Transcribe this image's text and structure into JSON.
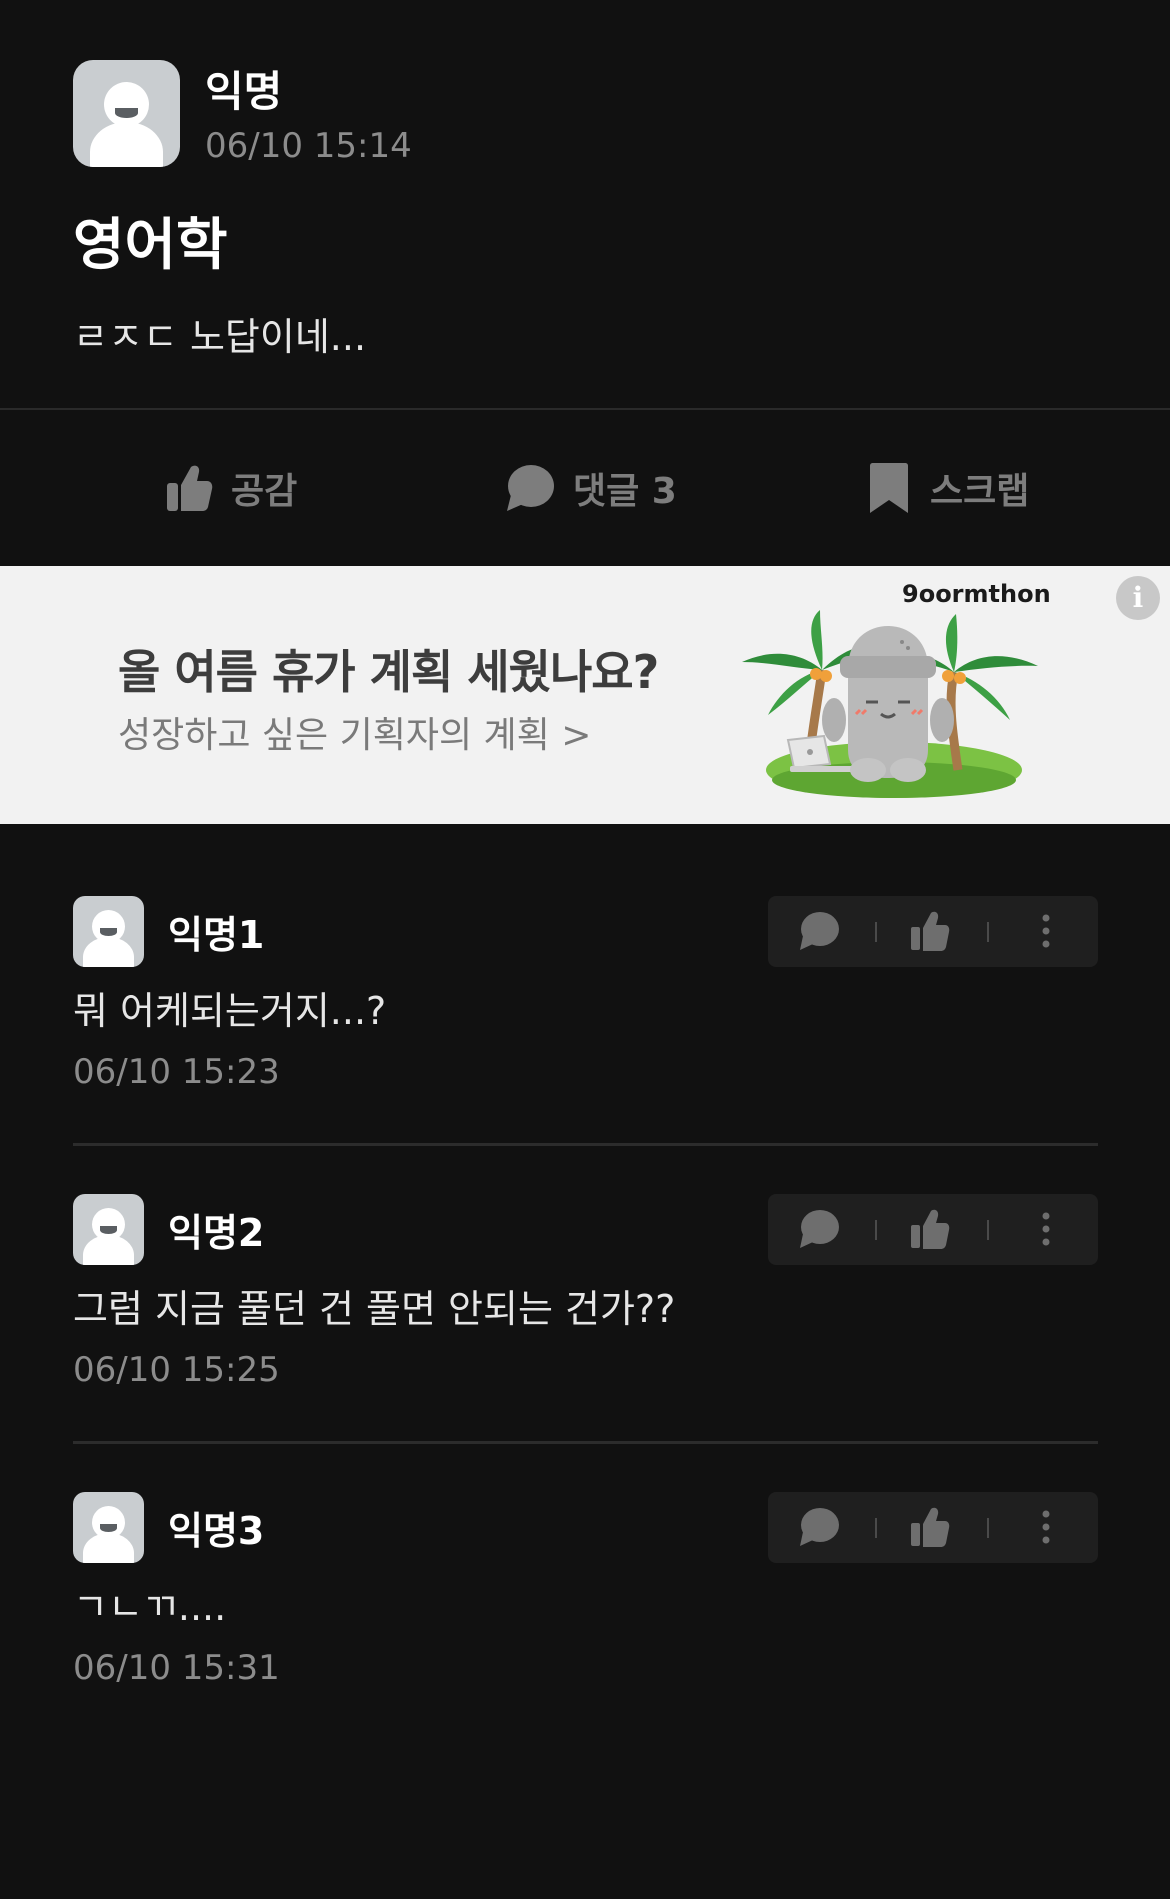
{
  "post": {
    "author": "익명",
    "time": "06/10 15:14",
    "title": "영어학",
    "body": "ㄹㅈㄷ 노답이네..."
  },
  "actions": {
    "like_label": "공감",
    "comment_label": "댓글 3",
    "scrap_label": "스크랩"
  },
  "ad": {
    "title": "올 여름 휴가 계획 세웠나요?",
    "subtitle": "성장하고 싶은 기획자의 계획 >",
    "brand": "9oormthon",
    "info": "i"
  },
  "comments": [
    {
      "author": "익명1",
      "body": "뭐 어케되는거지...?",
      "time": "06/10 15:23"
    },
    {
      "author": "익명2",
      "body": "그럼 지금 풀던 건 풀면 안되는 건가??",
      "time": "06/10 15:25"
    },
    {
      "author": "익명3",
      "body": "ㄱㄴㄲ....",
      "time": "06/10 15:31"
    }
  ],
  "colors": {
    "background": "#111111",
    "muted_text": "#8c8c8c",
    "action_gray": "#7d7d7d",
    "ad_background": "#f2f2f2"
  }
}
